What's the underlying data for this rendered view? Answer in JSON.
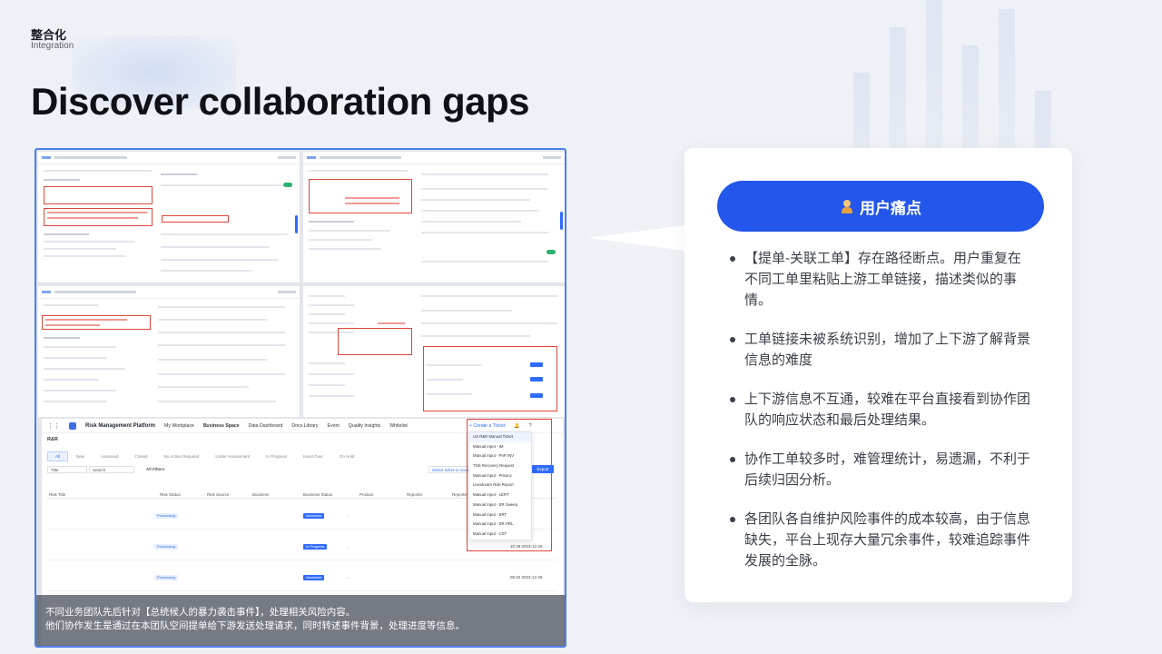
{
  "header": {
    "eyebrow_cn": "整合化",
    "eyebrow_en": "Integration",
    "title": "Discover collaboration gaps"
  },
  "screenshot": {
    "platform": {
      "brand": "Risk Management Platform",
      "nav": [
        "My Workplace",
        "Business Space",
        "Data Dashboard",
        "Docs Library",
        "Event",
        "Quality Insights",
        "Whitelist"
      ],
      "create_ticket": "+ Create a Ticket",
      "space": "R&R",
      "tabs": [
        "All",
        "New",
        "Assessed",
        "Closed",
        "No Action Required",
        "Under Assessment",
        "In Progress",
        "Hand Over",
        "On Hold"
      ],
      "filter_title": "Title",
      "search_placeholder": "Search",
      "all_filters": "All Filters",
      "select_ticket": "Select ticket to score",
      "export": "Export",
      "columns": [
        "Risk Title",
        "Risk Status",
        "Risk Source",
        "Business",
        "Business Status",
        "Product",
        "Reporter",
        "Reporter Team"
      ],
      "rows": [
        {
          "status": "Processing",
          "bstatus": "Assessed",
          "dash": "-",
          "time": ""
        },
        {
          "status": "Processing",
          "bstatus": "In Progress",
          "dash": "-",
          "time": "10:48 2023-12-26"
        },
        {
          "status": "Processing",
          "bstatus": "Assessed",
          "dash": "-",
          "time": "09:32 2023-12-26"
        }
      ],
      "dropdown": [
        "US R&R Manual Ticket",
        "Manual Input - IM",
        "Manual Input - PnP INV",
        "TNS Recovery Request",
        "Manual Input - Privacy",
        "Livestream Risk Report",
        "Manual Input - LERT",
        "Manual Input - ER Sweep",
        "Manual Input - ERT",
        "Manual Input - ER HRL",
        "Manual Input - CST"
      ]
    },
    "caption": {
      "line1": "不同业务团队先后针对【总统候人的暴力袭击事件】，处理相关风险内容。",
      "line2": "他们协作发生是通过在本团队空间提单给下游发送处理请求，同时转述事件背景，处理进度等信息。"
    }
  },
  "pain_points": {
    "title": "用户痛点",
    "icon": "user-icon",
    "items": [
      "【提单-关联工单】存在路径断点。用户重复在不同工单里粘贴上游工单链接，描述类似的事情。",
      "工单链接未被系统识别，增加了上下游了解背景信息的难度",
      "上下游信息不互通，较难在平台直接看到协作团队的响应状态和最后处理结果。",
      "协作工单较多时，难管理统计，易遗漏，不利于后续归因分析。",
      "各团队各自维护风险事件的成本较高，由于信息缺失，平台上现存大量冗余事件，较难追踪事件发展的全脉。"
    ]
  },
  "colors": {
    "accent": "#2356ea",
    "highlight_red": "#e0463b",
    "frame_blue": "#4d7fe8"
  }
}
